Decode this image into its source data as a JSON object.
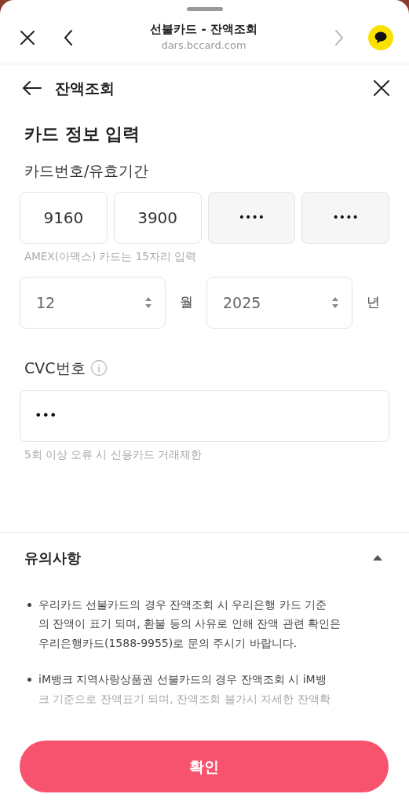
{
  "browser_bar": {
    "title": "선불카드 - 잔액조회",
    "url": "dars.bccard.com",
    "forward_disabled": true
  },
  "page_header": {
    "title": "잔액조회"
  },
  "section_title": "카드 정보 입력",
  "card_number": {
    "label": "카드번호/유효기간",
    "fields": [
      {
        "value": "9160",
        "masked": false
      },
      {
        "value": "3900",
        "masked": false
      },
      {
        "value": "••••",
        "masked": true
      },
      {
        "value": "••••",
        "masked": true
      }
    ],
    "hint": "AMEX(아맥스) 카드는 15자리 입력"
  },
  "expiry": [
    {
      "value": "12",
      "unit": "월"
    },
    {
      "value": "2025",
      "unit": "년"
    }
  ],
  "cvc": {
    "label": "CVC번호",
    "value": "•••",
    "hint": "5회 이상 오류 시 신용카드 거래제한"
  },
  "notice": {
    "title": "유의사항",
    "expanded": true,
    "items": [
      {
        "lines": [
          "우리카드 선불카드의 경우 잔액조회 시 우리은행 카드 기준",
          "의 잔액이 표기 되며, 환불 등의 사유로 인해 잔액 관련 확인은",
          "우리은행카드(1588-9955)로 문의 주시기 바랍니다."
        ]
      },
      {
        "lines": [
          "iM뱅크 지역사랑상품권 선불카드의 경우 잔액조회 시 iM뱅",
          "크 기준으로 잔액표기 되며, 잔액조회 불가시 자세한 잔액확"
        ]
      }
    ]
  },
  "confirm_button": "확인"
}
